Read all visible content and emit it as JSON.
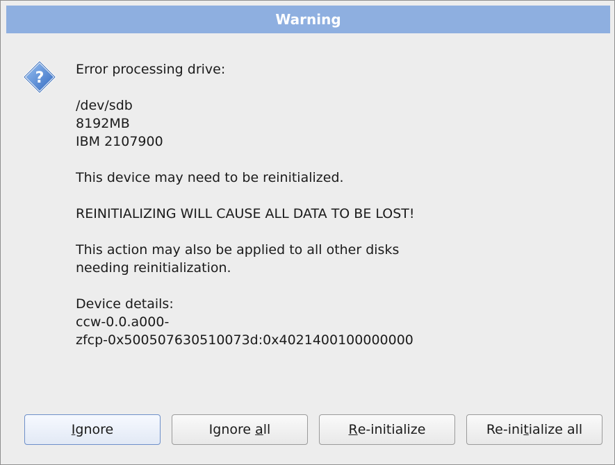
{
  "window": {
    "title": "Warning"
  },
  "message": {
    "heading": "Error processing drive:",
    "drive_path": "/dev/sdb",
    "drive_size": "8192MB",
    "drive_model": "IBM 2107900",
    "reinit_note": "This device may need to be reinitialized.",
    "data_loss_warning": "REINITIALIZING WILL CAUSE ALL DATA TO BE LOST!",
    "apply_all_note_line1": "This action may also be applied to all other disks",
    "apply_all_note_line2": "needing reinitialization.",
    "details_label": "Device details:",
    "details_line1": "ccw-0.0.a000-",
    "details_line2": "zfcp-0x500507630510073d:0x4021400100000000"
  },
  "icon": "question-diamond-icon",
  "buttons": {
    "ignore": {
      "pre": "",
      "mnemonic": "I",
      "post": "gnore"
    },
    "ignore_all": {
      "pre": "Ignore ",
      "mnemonic": "a",
      "post": "ll"
    },
    "reinitialize": {
      "pre": "",
      "mnemonic": "R",
      "post": "e-initialize"
    },
    "reinitialize_all": {
      "pre": "Re-ini",
      "mnemonic": "t",
      "post": "ialize all"
    }
  },
  "colors": {
    "titlebar": "#8eafe0",
    "background": "#ededed",
    "icon_fill": "#3f7fd6"
  }
}
